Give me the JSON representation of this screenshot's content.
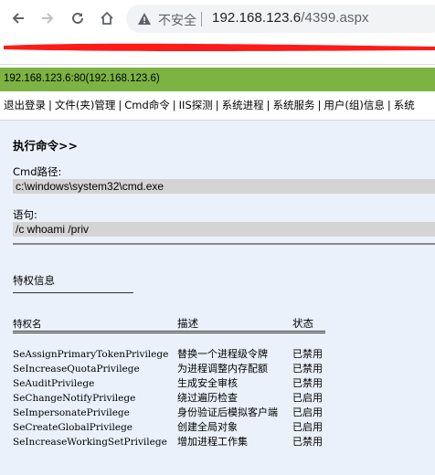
{
  "browser": {
    "insecure_label": "不安全",
    "url_host": "192.168.123.6",
    "url_path": "/4399.aspx"
  },
  "host_bar": {
    "text": "192.168.123.6:80(192.168.123.6)"
  },
  "menu": {
    "items": [
      "退出登录",
      "文件(夹)管理",
      "Cmd命令",
      "IIS探测",
      "系统进程",
      "系统服务",
      "用户(组)信息",
      "系统"
    ]
  },
  "command": {
    "title": "执行命令>>",
    "cmd_path_label": "Cmd路径:",
    "cmd_path_value": "c:\\windows\\system32\\cmd.exe",
    "statement_label": "语句:",
    "statement_value": "/c whoami /priv"
  },
  "privileges": {
    "title": "特权信息",
    "headers": [
      "特权名",
      "描述",
      "状态"
    ],
    "rows": [
      [
        "SeAssignPrimaryTokenPrivilege",
        "替换一个进程级令牌",
        "已禁用"
      ],
      [
        "SeIncreaseQuotaPrivilege",
        "为进程调整内存配额",
        "已禁用"
      ],
      [
        "SeAuditPrivilege",
        "生成安全审核",
        "已禁用"
      ],
      [
        "SeChangeNotifyPrivilege",
        "绕过遍历检查",
        "已启用"
      ],
      [
        "SeImpersonatePrivilege",
        "身份验证后模拟客户端",
        "已启用"
      ],
      [
        "SeCreateGlobalPrivilege",
        "创建全局对象",
        "已启用"
      ],
      [
        "SeIncreaseWorkingSetPrivilege",
        "增加进程工作集",
        "已禁用"
      ]
    ]
  },
  "colors": {
    "host_bar": "#7cb342",
    "content_bg": "#eaf1fb",
    "field_bg": "#d4d4d4",
    "redaction": "#ff1a1a"
  }
}
